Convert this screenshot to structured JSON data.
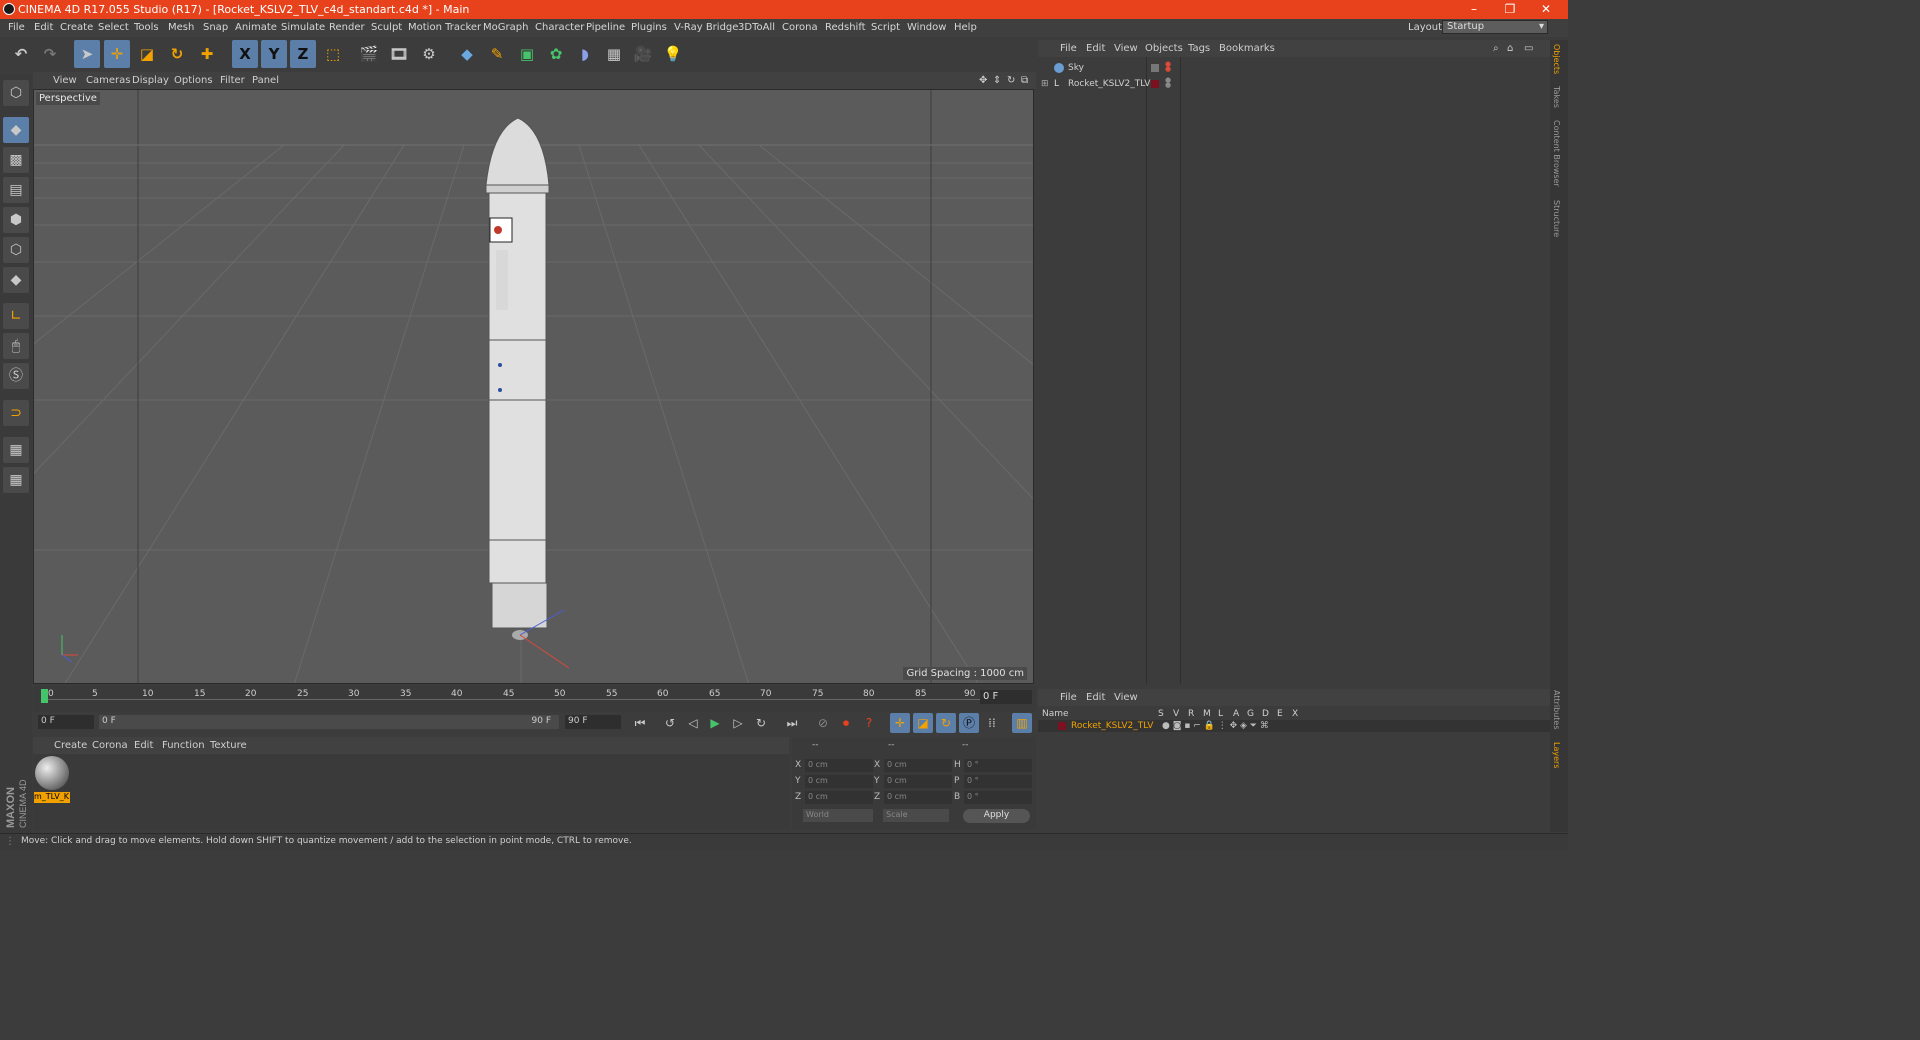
{
  "window": {
    "title": "CINEMA 4D R17.055 Studio (R17) - [Rocket_KSLV2_TLV_c4d_standart.c4d *] - Main",
    "controls": [
      "–",
      "❐",
      "✕"
    ]
  },
  "menubar": {
    "items": [
      "File",
      "Edit",
      "Create",
      "Select",
      "Tools",
      "Mesh",
      "Snap",
      "Animate",
      "Simulate",
      "Render",
      "Sculpt",
      "Motion Tracker",
      "MoGraph",
      "Character",
      "Pipeline",
      "Plugins",
      "V-Ray Bridge",
      "3DToAll",
      "Corona",
      "Redshift",
      "Script",
      "Window",
      "Help"
    ],
    "layout_label": "Layout:",
    "layout_value": "Startup"
  },
  "toolbar": {
    "icons": [
      "undo-icon",
      "redo-icon",
      "select-icon",
      "move-icon",
      "scale-icon",
      "rotate-icon",
      "transform-icon",
      "x-axis-icon",
      "y-axis-icon",
      "z-axis-icon",
      "world-coords-icon",
      "render-view-icon",
      "render-picture-icon",
      "render-settings-icon",
      "cube-icon",
      "pen-icon",
      "subdivision-icon",
      "cloner-icon",
      "deformer-icon",
      "floor-icon",
      "camera-icon",
      "light-icon"
    ],
    "axis_labels": [
      "X",
      "Y",
      "Z"
    ]
  },
  "viewport": {
    "menu": [
      "View",
      "Cameras",
      "Display",
      "Options",
      "Filter",
      "Panel"
    ],
    "camera_label": "Perspective",
    "grid_spacing": "Grid Spacing : 1000 cm"
  },
  "timeline": {
    "ticks": [
      "0",
      "5",
      "10",
      "15",
      "20",
      "25",
      "30",
      "35",
      "40",
      "45",
      "50",
      "55",
      "60",
      "65",
      "70",
      "75",
      "80",
      "85",
      "90"
    ],
    "current_frame": "0 F",
    "start_field": "0 F",
    "range_start": "0 F",
    "range_end": "90 F",
    "end_field": "90 F"
  },
  "materials": {
    "menu": [
      "Create",
      "Corona",
      "Edit",
      "Function",
      "Texture"
    ],
    "items": [
      {
        "label": "m_TLV_K"
      }
    ]
  },
  "coordinates": {
    "header": [
      "--",
      "--",
      "--"
    ],
    "rows": [
      {
        "axis": "X",
        "pos": "0 cm",
        "axis2": "X",
        "size": "0 cm",
        "rot_label": "H",
        "rot": "0 °"
      },
      {
        "axis": "Y",
        "pos": "0 cm",
        "axis2": "Y",
        "size": "0 cm",
        "rot_label": "P",
        "rot": "0 °"
      },
      {
        "axis": "Z",
        "pos": "0 cm",
        "axis2": "Z",
        "size": "0 cm",
        "rot_label": "B",
        "rot": "0 °"
      }
    ],
    "mode_select": "World",
    "size_select": "Scale",
    "apply": "Apply"
  },
  "objects_panel": {
    "menu": [
      "File",
      "Edit",
      "View",
      "Objects",
      "Tags",
      "Bookmarks"
    ],
    "items": [
      {
        "name": "Sky",
        "color": "#6a9ed2"
      },
      {
        "name": "Rocket_KSLV2_TLV",
        "color": "#7a1020"
      }
    ]
  },
  "layers_panel": {
    "menu": [
      "File",
      "Edit",
      "View"
    ],
    "columns": [
      "Name",
      "S",
      "V",
      "R",
      "M",
      "L",
      "A",
      "G",
      "D",
      "E",
      "X"
    ],
    "rows": [
      {
        "name": "Rocket_KSLV2_TLV",
        "color": "#7a1020"
      }
    ]
  },
  "sidetabs": [
    "Objects",
    "Takes",
    "Content Browser",
    "Structure",
    "Attributes",
    "Layers"
  ],
  "status": {
    "text": "Move: Click and drag to move elements. Hold down SHIFT to quantize movement / add to the selection in point mode, CTRL to remove."
  },
  "branding": {
    "maxon": "MAXON",
    "product": "CINEMA 4D"
  },
  "colors": {
    "accent": "#e7421c",
    "active_tool": "#5b7fa8",
    "layer_name": "#f2a200"
  }
}
